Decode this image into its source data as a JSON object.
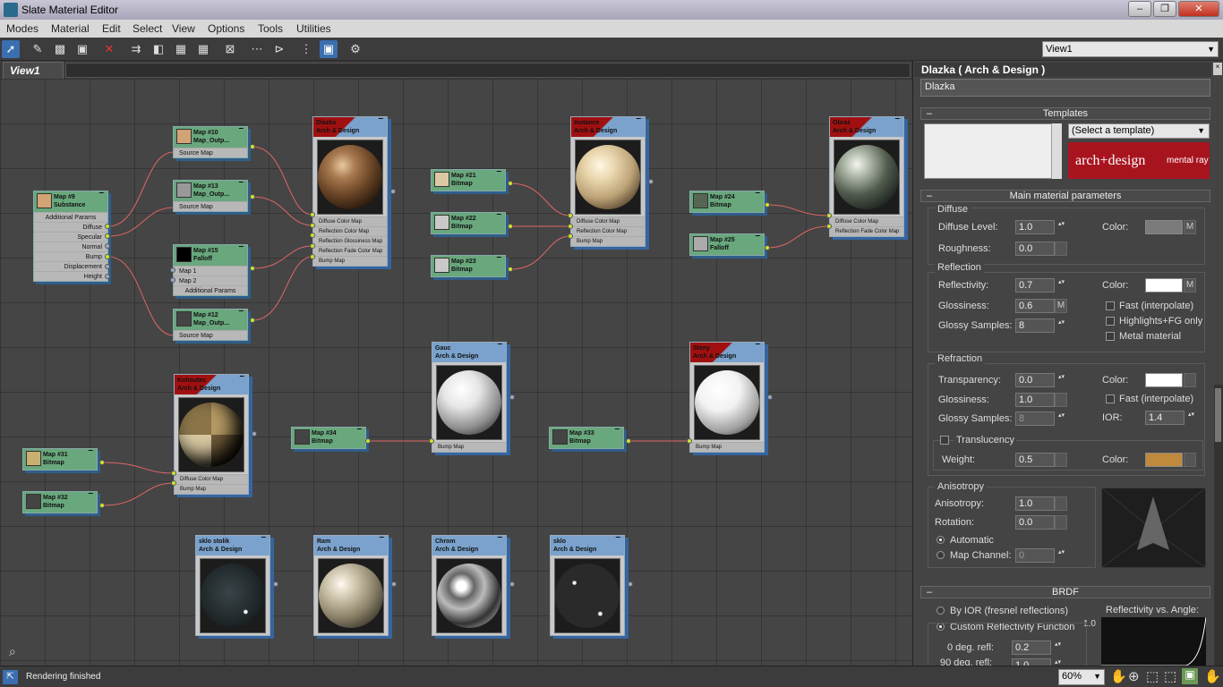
{
  "window": {
    "title": "Slate Material Editor",
    "min": "–",
    "max": "❐",
    "close": "✕"
  },
  "menu": [
    "Modes",
    "Material",
    "Edit",
    "Select",
    "View",
    "Options",
    "Tools",
    "Utilities"
  ],
  "toolbar": {
    "icons": [
      "select-icon",
      "eyedropper-icon",
      "put-to-scene-icon",
      "assign-icon",
      "delete-icon",
      "move-children-icon",
      "hide-unused-icon",
      "show-map-icon",
      "background-icon",
      "shaded-icon",
      "layout-icon",
      "layout-children-icon",
      "parameter-editor-icon",
      "material-map-browser-icon",
      "options-icon"
    ],
    "view_select": "View1"
  },
  "tabs": {
    "active": "View1"
  },
  "nodes": {
    "map9": {
      "title": "Map #9",
      "sub": "Substance",
      "color": "#d2a374",
      "rows": [
        "Additional Params",
        "Diffuse",
        "Specular",
        "Normal",
        "Bump",
        "Displacement",
        "Height"
      ]
    },
    "map10": {
      "title": "Map #10",
      "sub": "Map_Outp...",
      "color": "#d2a374",
      "rows": [
        "Source Map"
      ]
    },
    "map13": {
      "title": "Map #13",
      "sub": "Map_Outp...",
      "color": "#999999",
      "rows": [
        "Source Map"
      ]
    },
    "map15": {
      "title": "Map #15",
      "sub": "Falloff",
      "color": "#000000",
      "rows": [
        "Map 1",
        "Map 2",
        "Additional Params"
      ]
    },
    "map12": {
      "title": "Map #12",
      "sub": "Map_Outp...",
      "color": "#444444",
      "rows": [
        "Source Map"
      ]
    },
    "map21": {
      "title": "Map #21",
      "sub": "Bitmap",
      "color": "#dcc9a3"
    },
    "map22": {
      "title": "Map #22",
      "sub": "Bitmap",
      "color": "#c9c9c9"
    },
    "map23": {
      "title": "Map #23",
      "sub": "Bitmap",
      "color": "#c9c9c9"
    },
    "map24": {
      "title": "Map #24",
      "sub": "Bitmap",
      "color": "#556655"
    },
    "map25": {
      "title": "Map #25",
      "sub": "Falloff",
      "color": "#aaaaaa"
    },
    "map31": {
      "title": "Map #31",
      "sub": "Bitmap",
      "color": "#c9b070"
    },
    "map32": {
      "title": "Map #32",
      "sub": "Bitmap",
      "color": "#444444"
    },
    "map34": {
      "title": "Map #34",
      "sub": "Bitmap",
      "color": "#444444"
    },
    "map33": {
      "title": "Map #33",
      "sub": "Bitmap",
      "color": "#444444"
    }
  },
  "materials": {
    "dlazka": {
      "name": "Dlazka",
      "type": "Arch & Design",
      "rows": [
        "Diffuse Color Map",
        "Reflection Color Map",
        "Reflection Glossiness Map",
        "Reflection Fade Color Map",
        "Bump Map"
      ]
    },
    "instance": {
      "name": "Instance",
      "type": "Arch & Design",
      "rows": [
        "Diffuse Color Map",
        "Reflection Color Map",
        "Bump Map"
      ]
    },
    "obraz": {
      "name": "Obraz",
      "type": "Arch & Design",
      "rows": [
        "Diffuse Color Map",
        "Reflection Fade Color Map"
      ]
    },
    "kohoutec": {
      "name": "Kohoutec",
      "type": "Arch & Design",
      "rows": [
        "Diffuse Color Map",
        "Bump Map"
      ]
    },
    "gauc": {
      "name": "Gauc",
      "type": "Arch & Design",
      "rows": [
        "Bump Map"
      ]
    },
    "steny": {
      "name": "Steny",
      "type": "Arch & Design",
      "rows": [
        "Bump Map"
      ]
    },
    "sklo_stolik": {
      "name": "sklo stolik",
      "type": "Arch & Design"
    },
    "ram": {
      "name": "Ram",
      "type": "Arch & Design"
    },
    "chrom": {
      "name": "Chrom",
      "type": "Arch & Design"
    },
    "sklo": {
      "name": "sklo",
      "type": "Arch & Design"
    }
  },
  "panel": {
    "title": "Dlazka  ( Arch & Design )",
    "name": "Dlazka",
    "templates": {
      "header": "Templates",
      "select": "(Select a template)",
      "logo": "arch+design",
      "logo2": "mental ray"
    },
    "main": {
      "header": "Main material parameters",
      "diffuse": {
        "header": "Diffuse",
        "level_label": "Diffuse Level:",
        "level": "1.0",
        "rough_label": "Roughness:",
        "rough": "0.0",
        "color_label": "Color:",
        "m": "M"
      },
      "reflection": {
        "header": "Reflection",
        "refl_label": "Reflectivity:",
        "refl": "0.7",
        "gloss_label": "Glossiness:",
        "gloss": "0.6",
        "samples_label": "Glossy Samples:",
        "samples": "8",
        "color_label": "Color:",
        "m": "M",
        "fast": "Fast (interpolate)",
        "highlights": "Highlights+FG only",
        "metal": "Metal material"
      },
      "refraction": {
        "header": "Refraction",
        "trans_label": "Transparency:",
        "trans": "0.0",
        "gloss_label": "Glossiness:",
        "gloss": "1.0",
        "samples_label": "Glossy Samples:",
        "samples": "8",
        "color_label": "Color:",
        "fast": "Fast (interpolate)",
        "ior_label": "IOR:",
        "ior": "1.4",
        "transl": "Translucency",
        "weight_label": "Weight:",
        "weight": "0.5",
        "tcolor_label": "Color:"
      },
      "aniso": {
        "header": "Anisotropy",
        "aniso_label": "Anisotropy:",
        "aniso": "1.0",
        "rot_label": "Rotation:",
        "rot": "0.0",
        "auto": "Automatic",
        "channel_label": "Map Channel:",
        "channel": "0"
      }
    },
    "brdf": {
      "header": "BRDF",
      "by_ior": "By IOR (fresnel reflections)",
      "custom": "Custom Reflectivity Function",
      "graph_title": "Reflectivity vs. Angle:",
      "graph_val": "1.0",
      "deg0_label": "0 deg. refl:",
      "deg0": "0.2",
      "deg90_label": "90 deg. refl:",
      "deg90": "1.0"
    }
  },
  "colors": {
    "diffuse": "#7b7b7b",
    "reflection": "#ffffff",
    "refraction": "#ffffff",
    "translucency": "#c08a3c"
  },
  "status": {
    "text": "Rendering finished",
    "zoom": "60%"
  }
}
